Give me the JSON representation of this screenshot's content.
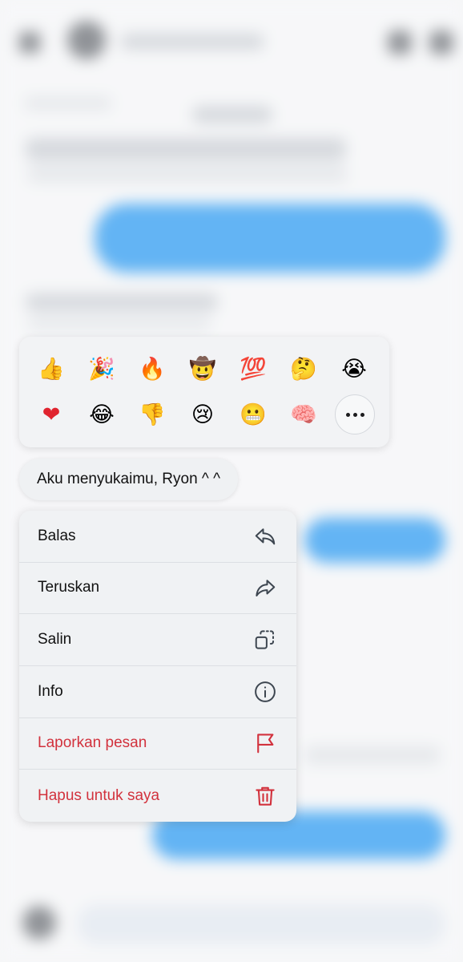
{
  "reactions": [
    {
      "icon": "thumbs-up-icon",
      "glyph": "👍"
    },
    {
      "icon": "party-popper-icon",
      "glyph": "🎉"
    },
    {
      "icon": "fire-icon",
      "glyph": "🔥"
    },
    {
      "icon": "cowboy-face-icon",
      "glyph": "🤠"
    },
    {
      "icon": "hundred-points-icon",
      "glyph": "💯"
    },
    {
      "icon": "thinking-face-icon",
      "glyph": "🤔"
    },
    {
      "icon": "loudly-crying-face-icon",
      "glyph": "😭"
    },
    {
      "icon": "red-heart-icon",
      "glyph": "❤"
    },
    {
      "icon": "tears-of-joy-icon",
      "glyph": "😂"
    },
    {
      "icon": "thumbs-down-icon",
      "glyph": "👎"
    },
    {
      "icon": "crying-face-icon",
      "glyph": "😢"
    },
    {
      "icon": "grimacing-face-icon",
      "glyph": "😬"
    },
    {
      "icon": "brain-icon",
      "glyph": "🧠"
    }
  ],
  "message": {
    "text": "Aku menyukaimu, Ryon ^ ^"
  },
  "menu": {
    "reply": "Balas",
    "forward": "Teruskan",
    "copy": "Salin",
    "info": "Info",
    "report": "Laporkan pesan",
    "delete": "Hapus untuk saya"
  },
  "colors": {
    "danger": "#d2323d",
    "accent": "#2f9bf0",
    "icon": "#3d4650"
  }
}
